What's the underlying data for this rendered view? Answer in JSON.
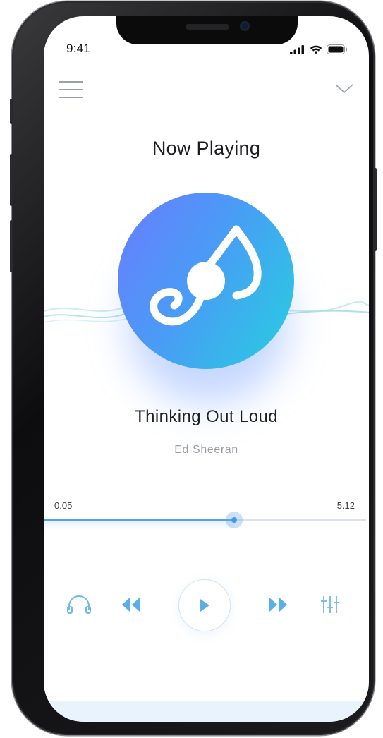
{
  "status_bar": {
    "time": "9:41"
  },
  "header": {
    "menu_icon": "hamburger-menu-icon",
    "collapse_icon": "chevron-down-icon",
    "title": "Now Playing"
  },
  "track": {
    "title": "Thinking Out Loud",
    "artist": "Ed Sheeran",
    "artwork_icon": "music-note-icon"
  },
  "progress": {
    "current": "0.05",
    "total": "5.12",
    "fraction": 0.59
  },
  "controls": {
    "headphones_icon": "headphones-icon",
    "rewind_icon": "rewind-icon",
    "play_icon": "play-icon",
    "forward_icon": "fast-forward-icon",
    "equalizer_icon": "equalizer-icon"
  },
  "colors": {
    "accent": "#4ea3ea",
    "gradient_start": "#6a7cff",
    "gradient_end": "#26cfe0"
  }
}
